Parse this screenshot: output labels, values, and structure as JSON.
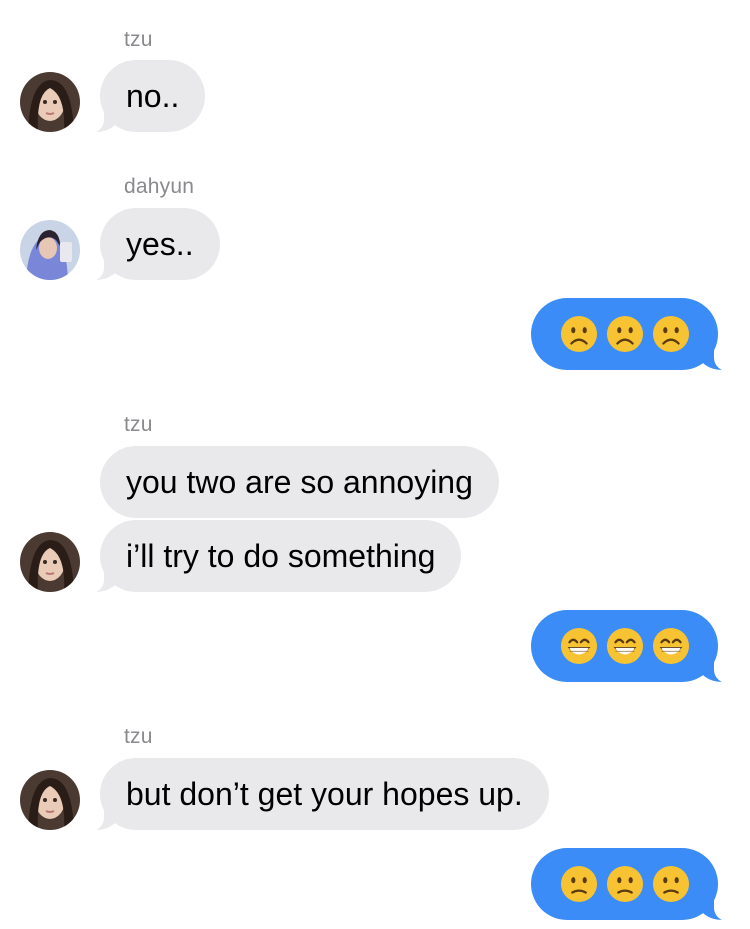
{
  "conversation": {
    "messages": [
      {
        "sender": "tzu",
        "text": "no.."
      },
      {
        "sender": "dahyun",
        "text": "yes.."
      },
      {
        "outgoing_emojis": [
          "frowning-face",
          "frowning-face",
          "frowning-face"
        ]
      },
      {
        "sender": "tzu",
        "texts": [
          "you two are so annoying",
          "i’ll try to do something"
        ]
      },
      {
        "outgoing_emojis": [
          "grinning-face-with-smiling-eyes",
          "grinning-face-with-smiling-eyes",
          "grinning-face-with-smiling-eyes"
        ]
      },
      {
        "sender": "tzu",
        "text": "but don’t get your hopes up."
      },
      {
        "outgoing_emojis": [
          "slightly-frowning-face",
          "slightly-frowning-face",
          "slightly-frowning-face"
        ]
      }
    ]
  },
  "m1": {
    "sender": "tzu",
    "text": "no.."
  },
  "m2": {
    "sender": "dahyun",
    "text": "yes.."
  },
  "m4": {
    "sender": "tzu",
    "text1": "you two are so annoying",
    "text2": "i’ll try to do something"
  },
  "m6": {
    "sender": "tzu",
    "text": "but don’t get your hopes up."
  },
  "colors": {
    "incoming_bubble": "#e9e9eb",
    "outgoing_bubble": "#3b8cf7",
    "sender_label": "#8a8a8e",
    "emoji_yellow": "#f7c332"
  }
}
